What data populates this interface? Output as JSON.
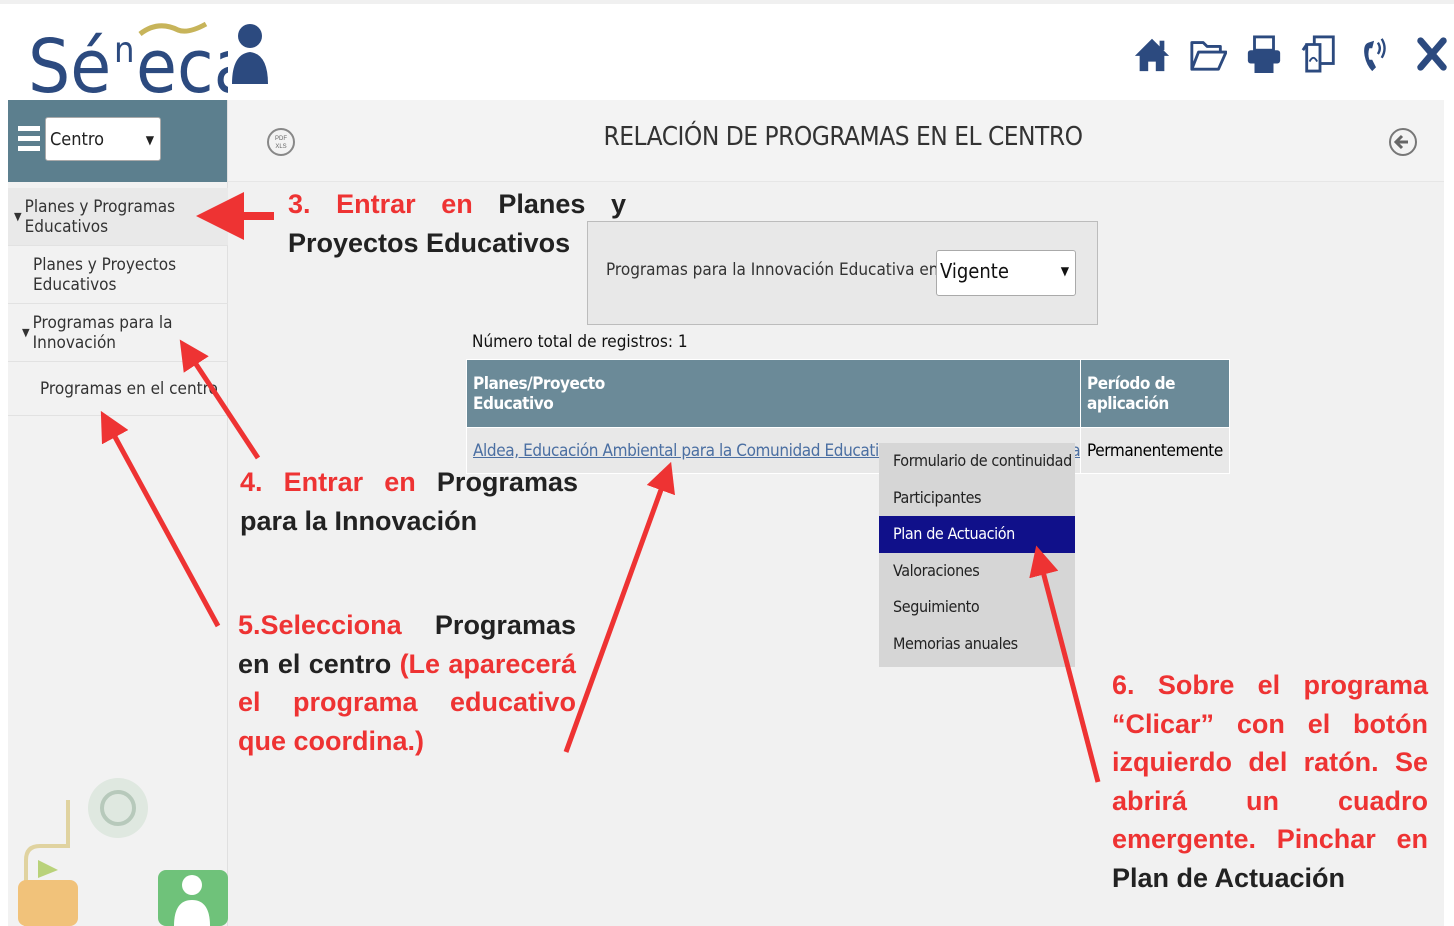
{
  "app": {
    "logo_text": "Séneca"
  },
  "header": {
    "icons": [
      "home-icon",
      "folder-open-icon",
      "printer-icon",
      "documents-icon",
      "phone-icon",
      "close-icon"
    ]
  },
  "sidebar": {
    "select_value": "Centro",
    "items": [
      {
        "label": "Planes y Programas Educativos",
        "type": "group"
      },
      {
        "label": "Planes y Proyectos Educativos",
        "type": "link"
      },
      {
        "label": "Programas para la Innovación",
        "type": "group"
      },
      {
        "label": "Programas en el centro",
        "type": "link"
      }
    ]
  },
  "page": {
    "title": "RELACIÓN DE PROGRAMAS EN EL CENTRO"
  },
  "filter": {
    "label": "Programas para la Innovación Educativa en situación de:",
    "value": "Vigente"
  },
  "records": {
    "total_label": "Número total de registros: 1"
  },
  "table": {
    "headers": [
      "Planes/Proyecto Educativo",
      "Período de aplicación"
    ],
    "rows": [
      {
        "programa": "Aldea, Educación Ambiental para la Comunidad Educativa - Modalidad A (Red Andaluza de Ecoescuelas)",
        "periodo": "Permanentemente"
      }
    ]
  },
  "context_menu": {
    "items": [
      "Formulario de continuidad",
      "Participantes",
      "Plan de Actuación",
      "Valoraciones",
      "Seguimiento",
      "Memorias anuales"
    ],
    "selected": "Plan de Actuación"
  },
  "annotations": {
    "a3": {
      "red": "3. Entrar en",
      "dark": "Planes y Proyectos Educativos"
    },
    "a4": {
      "red": "4. Entrar en",
      "dark": "Programas para la Innovación"
    },
    "a5": {
      "red1": "5.Selecciona",
      "dark": "Programas en el centro",
      "red2": "(Le aparecerá el programa educativo que coordina.)"
    },
    "a6": {
      "red": "6. Sobre el programa “Clicar” con el botón izquierdo del ratón. Se abrirá un cuadro emergente. Pinchar en",
      "dark": "Plan de Actuación"
    }
  },
  "colors": {
    "accent_red": "#ee3333",
    "header_teal": "#5c7f8e",
    "table_header": "#6b8a98",
    "menu_selected": "#10108a",
    "logo_blue": "#2c4a7f"
  }
}
